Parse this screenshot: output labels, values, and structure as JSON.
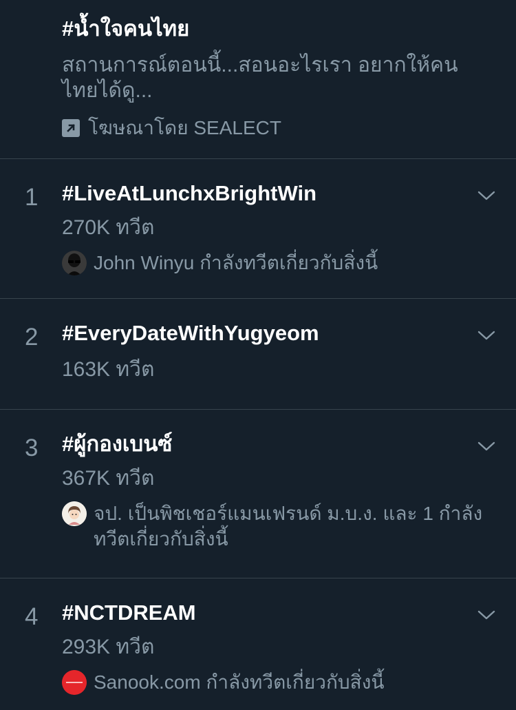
{
  "promoted": {
    "title": "#น้ำใจคนไทย",
    "description": "สถานการณ์ตอนนี้...สอนอะไรเรา อยากให้คนไทยได้ดู...",
    "promoted_label": "โฆษณาโดย SEALECT",
    "icon": "promoted-arrow-icon"
  },
  "trends": [
    {
      "rank": "1",
      "title": "#LiveAtLunchxBrightWin",
      "count": "270K ทวีต",
      "context": "John Winyu กำลังทวีตเกี่ยวกับสิ่งนี้",
      "avatar_color": "#2b2b2b"
    },
    {
      "rank": "2",
      "title": "#EveryDateWithYugyeom",
      "count": "163K ทวีต"
    },
    {
      "rank": "3",
      "title": "#ผู้กองเบนซ์",
      "count": "367K ทวีต",
      "context": "จป. เป็นพิชเชอร์แมนเฟรนด์ ม.บ.ง. และ 1 กำลังทวีตเกี่ยวกับสิ่งนี้",
      "avatar_color": "#f3efe8"
    },
    {
      "rank": "4",
      "title": "#NCTDREAM",
      "count": "293K ทวีต",
      "context": "Sanook.com กำลังทวีตเกี่ยวกับสิ่งนี้",
      "avatar_color": "#e5262b"
    }
  ],
  "colors": {
    "background": "#15202b",
    "divider": "#38444d",
    "secondary_text": "#8899a6",
    "primary_text": "#ffffff"
  }
}
